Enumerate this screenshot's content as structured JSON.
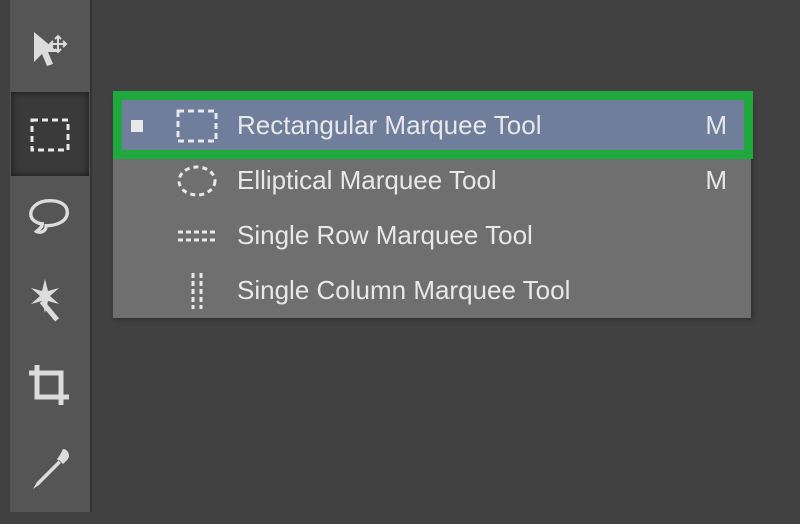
{
  "toolbar": {
    "tools": [
      {
        "name": "move-tool"
      },
      {
        "name": "marquee-tool",
        "active": true
      },
      {
        "name": "lasso-tool"
      },
      {
        "name": "magic-wand-tool"
      },
      {
        "name": "crop-tool"
      },
      {
        "name": "eyedropper-tool"
      }
    ]
  },
  "flyout": {
    "items": [
      {
        "label": "Rectangular Marquee Tool",
        "shortcut": "M",
        "icon": "rect-marquee-icon",
        "selected": true
      },
      {
        "label": "Elliptical Marquee Tool",
        "shortcut": "M",
        "icon": "ellipse-marquee-icon",
        "selected": false
      },
      {
        "label": "Single Row Marquee Tool",
        "shortcut": "",
        "icon": "row-marquee-icon",
        "selected": false
      },
      {
        "label": "Single Column Marquee Tool",
        "shortcut": "",
        "icon": "column-marquee-icon",
        "selected": false
      }
    ]
  }
}
